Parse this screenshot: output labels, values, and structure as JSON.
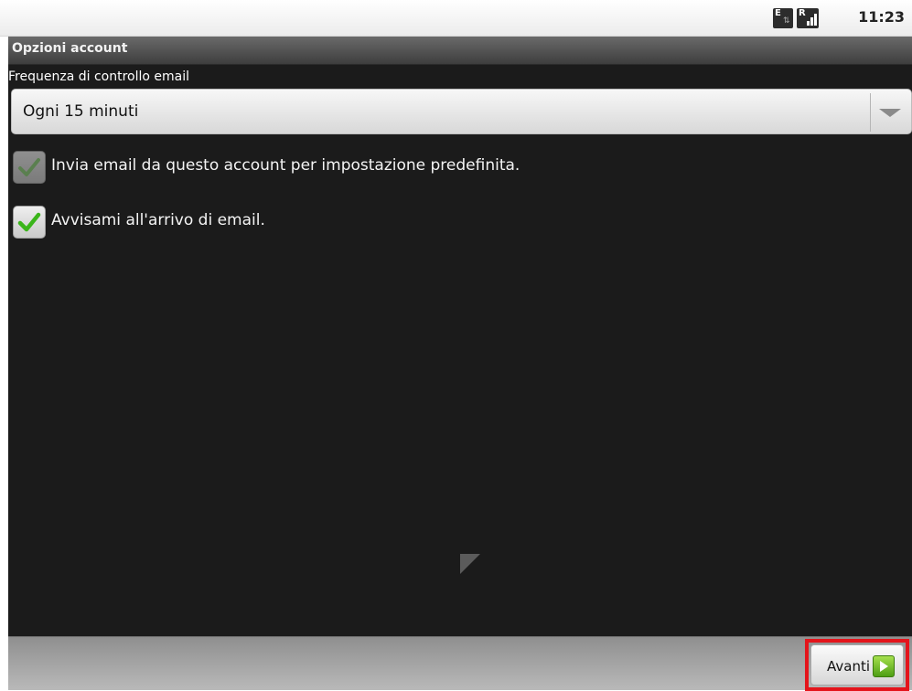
{
  "status_bar": {
    "data_icon_letter": "E",
    "signal_icon_letter": "R",
    "time": "11:23"
  },
  "screen": {
    "title": "Opzioni account",
    "frequency": {
      "label": "Frequenza di controllo email",
      "selected": "Ogni 15 minuti"
    },
    "checkboxes": [
      {
        "label": "Invia email da questo account per impostazione predefinita.",
        "checked": true,
        "enabled": false
      },
      {
        "label": "Avvisami all'arrivo di email.",
        "checked": true,
        "enabled": true
      }
    ],
    "next_button_label": "Avanti"
  },
  "colors": {
    "background": "#1b1b1b",
    "check_green": "#3ab51a",
    "highlight_border": "#e4141b"
  },
  "icons": {
    "data": "data-connection-icon",
    "signal": "roaming-signal-icon",
    "checkmark": "checkmark-icon",
    "dropdown": "dropdown-arrow-icon",
    "next": "arrow-right-icon"
  }
}
